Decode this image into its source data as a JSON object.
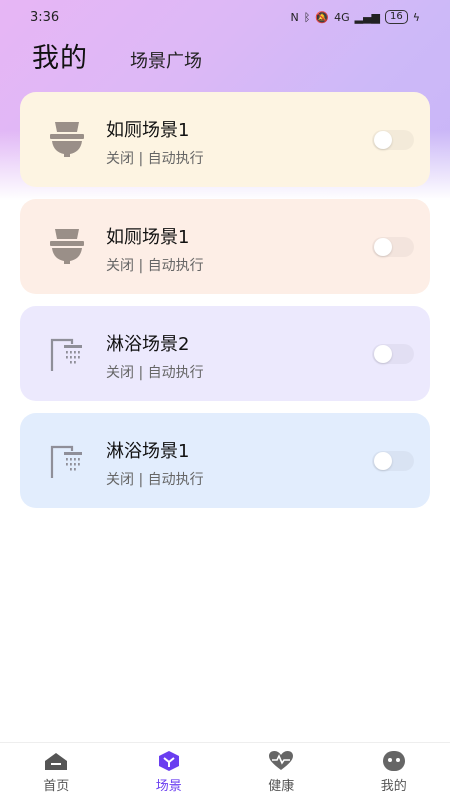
{
  "status_bar": {
    "time": "3:36",
    "network": "4G",
    "battery": "16"
  },
  "header": {
    "title": "我的",
    "tab": "场景广场"
  },
  "scenes": [
    {
      "name": "如厕场景1",
      "meta": "关闭 | 自动执行",
      "icon": "toilet-icon",
      "bg": "#fdf4e2"
    },
    {
      "name": "如厕场景1",
      "meta": "关闭 | 自动执行",
      "icon": "toilet-icon",
      "bg": "#fdeee6"
    },
    {
      "name": "淋浴场景2",
      "meta": "关闭 | 自动执行",
      "icon": "shower-icon",
      "bg": "#ece9fd"
    },
    {
      "name": "淋浴场景1",
      "meta": "关闭 | 自动执行",
      "icon": "shower-icon",
      "bg": "#e2edfd"
    }
  ],
  "tabbar": [
    {
      "label": "首页",
      "icon": "home-icon"
    },
    {
      "label": "场景",
      "icon": "scene-icon",
      "active": true
    },
    {
      "label": "健康",
      "icon": "heart-icon"
    },
    {
      "label": "我的",
      "icon": "face-icon"
    }
  ],
  "colors": {
    "accent": "#6a3ef0",
    "icon_gray": "#9a8f88"
  }
}
